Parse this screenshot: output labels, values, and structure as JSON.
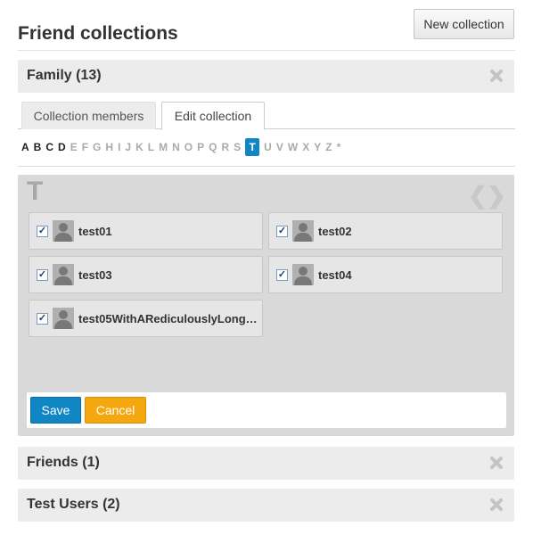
{
  "page": {
    "title": "Friend collections",
    "new_collection_label": "New collection"
  },
  "collections": [
    {
      "name": "Family (13)"
    },
    {
      "name": "Friends (1)"
    },
    {
      "name": "Test Users (2)"
    }
  ],
  "tabs": {
    "members": "Collection members",
    "edit": "Edit collection"
  },
  "alphabet": {
    "letters": [
      "A",
      "B",
      "C",
      "D",
      "E",
      "F",
      "G",
      "H",
      "I",
      "J",
      "K",
      "L",
      "M",
      "N",
      "O",
      "P",
      "Q",
      "R",
      "S",
      "T",
      "U",
      "V",
      "W",
      "X",
      "Y",
      "Z",
      "*"
    ],
    "enabled": [
      "A",
      "B",
      "C",
      "D",
      "T"
    ],
    "selected": "T"
  },
  "panel": {
    "current_letter": "T",
    "prev_glyph": "❮",
    "next_glyph": "❯",
    "members": [
      {
        "name": "test01",
        "checked": true
      },
      {
        "name": "test02",
        "checked": true
      },
      {
        "name": "test03",
        "checked": true
      },
      {
        "name": "test04",
        "checked": true
      },
      {
        "name": "test05WithARediculouslyLong…",
        "checked": true
      }
    ]
  },
  "actions": {
    "save": "Save",
    "cancel": "Cancel"
  },
  "icons": {
    "close": "close-x-icon",
    "avatar": "user-avatar-icon",
    "checkbox": "checkbox-icon"
  },
  "colors": {
    "primary": "#1186c5",
    "warning": "#f5a70f",
    "header_bg": "#ececec",
    "panel_bg": "#d9d9d9"
  }
}
